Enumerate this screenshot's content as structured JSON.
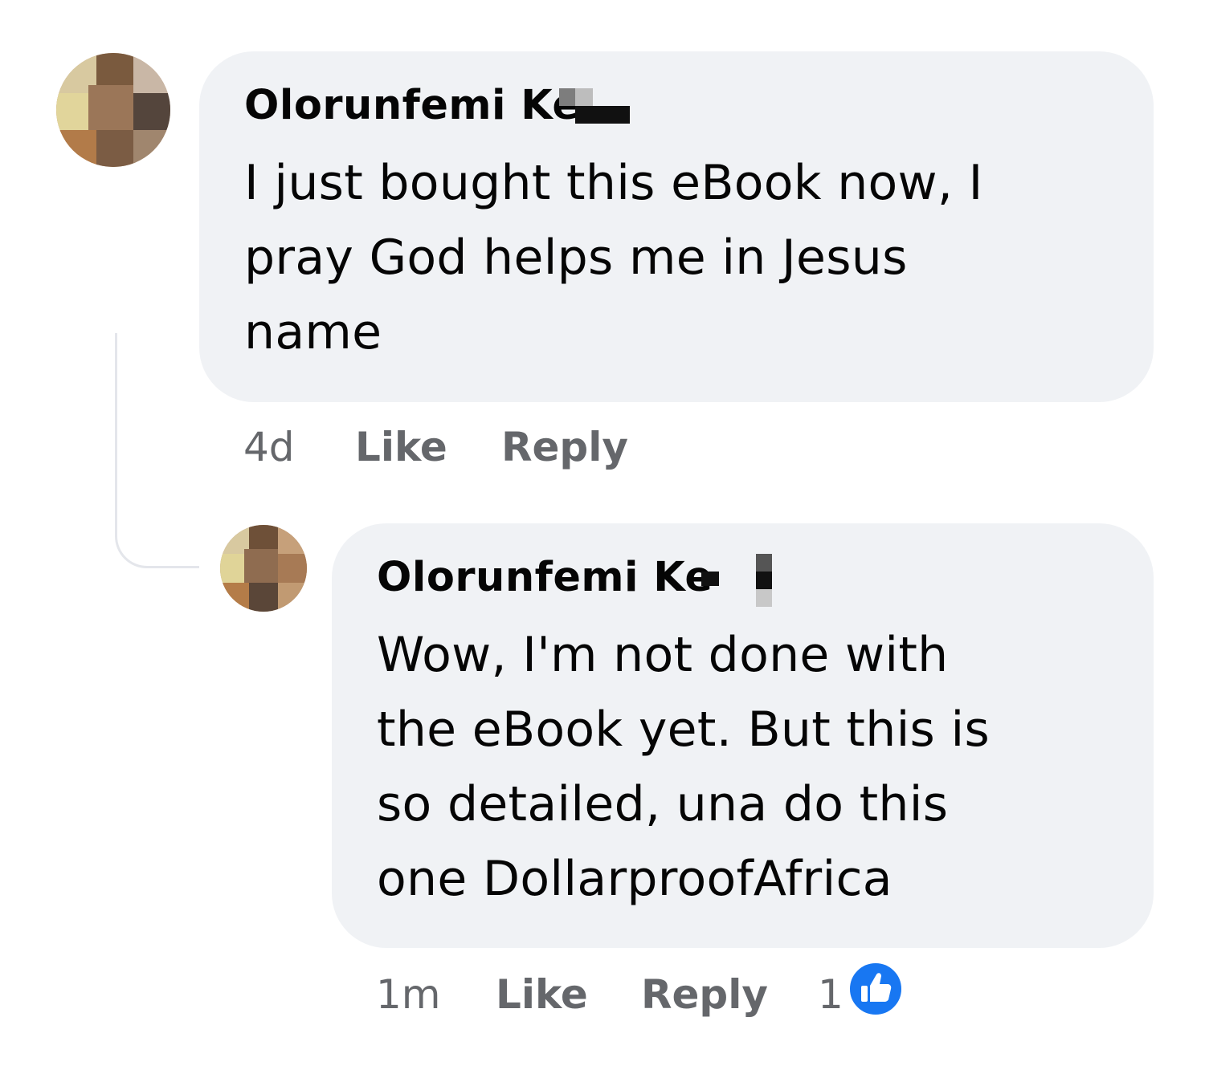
{
  "comments": [
    {
      "author": "Olorunfemi Ke",
      "lines": [
        "I just bought this eBook now, I",
        "pray God helps me in Jesus",
        "name"
      ],
      "time": "4d",
      "like_label": "Like",
      "reply_label": "Reply"
    },
    {
      "author": "Olorunfemi Ke",
      "lines": [
        "Wow, I'm not done with",
        "the eBook yet. But this is",
        "so detailed, una do this",
        "one DollarproofAfrica"
      ],
      "time": "1m",
      "like_label": "Like",
      "reply_label": "Reply",
      "reaction_count": "1",
      "reaction_icon": "thumbs-up-icon"
    }
  ],
  "colors": {
    "bubble": "#f0f2f5",
    "meta_text": "#65676b",
    "like_badge": "#1877f2",
    "thread_line": "#e4e6eb"
  }
}
